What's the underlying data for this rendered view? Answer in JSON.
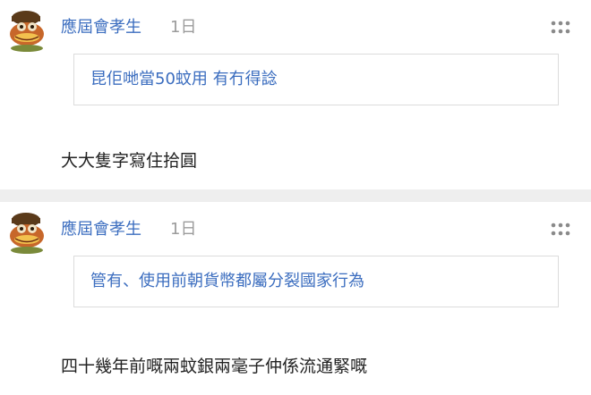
{
  "posts": [
    {
      "username": "應屆會孝生",
      "timestamp": "1日",
      "quote": "昆佢哋當50蚊用 有冇得諗",
      "body": "大大隻字寫住拾圓",
      "avatar_icon": "frog-avatar-icon",
      "more_icon": "more-dots-icon"
    },
    {
      "username": "應屆會孝生",
      "timestamp": "1日",
      "quote": "管有、使用前朝貨幣都屬分裂國家行為",
      "body": "四十幾年前嘅兩蚊銀兩毫子仲係流通緊嘅",
      "avatar_icon": "frog-avatar-icon",
      "more_icon": "more-dots-icon"
    }
  ],
  "colors": {
    "username": "#3b6dbf",
    "quote_text": "#3b6dbf",
    "timestamp": "#9b9b9b",
    "body_text": "#222222",
    "separator": "#eeeeee",
    "quote_border": "#dcdcdc"
  }
}
